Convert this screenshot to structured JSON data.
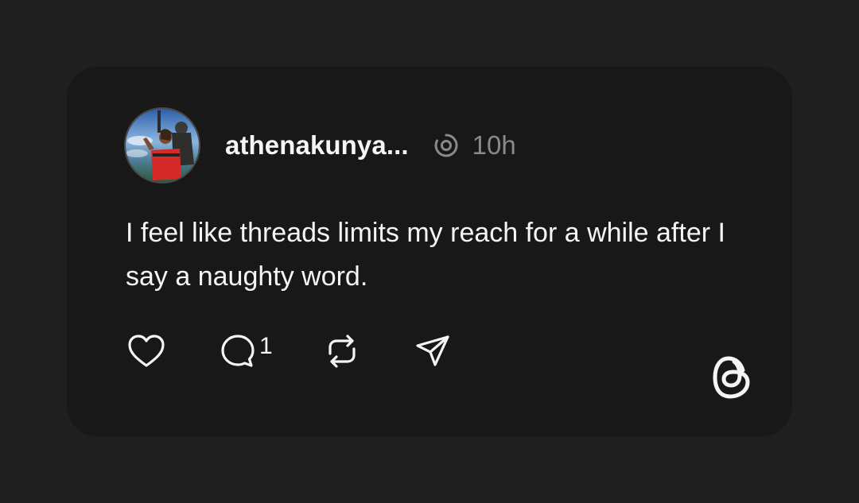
{
  "post": {
    "author": {
      "username": "athenakunya...",
      "avatar_icon": "avatar-photo"
    },
    "status_icon": "threads-circle-icon",
    "timestamp": "10h",
    "text": "I feel like threads limits my reach for a while after I say a naughty word.",
    "actions": {
      "like_icon": "heart-icon",
      "reply_icon": "comment-icon",
      "reply_count": "1",
      "repost_icon": "repost-icon",
      "share_icon": "send-icon"
    },
    "brand_icon": "threads-logo-icon"
  },
  "colors": {
    "page_background": "#1f1f1f",
    "card_background": "#181818",
    "primary_text": "#f3f5f7",
    "secondary_text": "#8a8a8a"
  }
}
